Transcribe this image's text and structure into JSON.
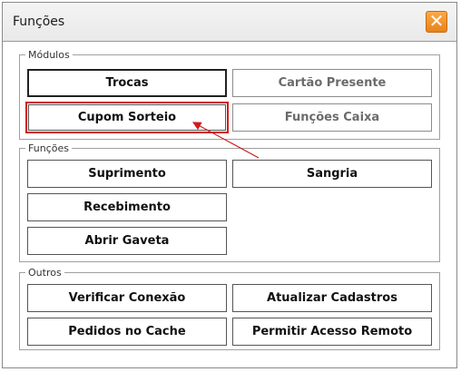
{
  "window": {
    "title": "Funções",
    "close_icon": "close-x-icon",
    "close_color": "#F0901E"
  },
  "modulos": {
    "legend": "Módulos",
    "trocas": "Trocas",
    "cartao_presente": "Cartão Presente",
    "cupom_sorteio": "Cupom Sorteio",
    "funcoes_caixa": "Funções Caixa"
  },
  "funcoes": {
    "legend": "Funções",
    "suprimento": "Suprimento",
    "sangria": "Sangria",
    "recebimento": "Recebimento",
    "abrir_gaveta": "Abrir Gaveta"
  },
  "outros": {
    "legend": "Outros",
    "verificar_conexao": "Verificar Conexão",
    "atualizar_cadastros": "Atualizar Cadastros",
    "pedidos_cache": "Pedidos no Cache",
    "permitir_acesso_remoto": "Permitir Acesso Remoto"
  },
  "annotation": {
    "highlight_color": "#D11A1A",
    "arrow_target": "Cupom Sorteio"
  }
}
